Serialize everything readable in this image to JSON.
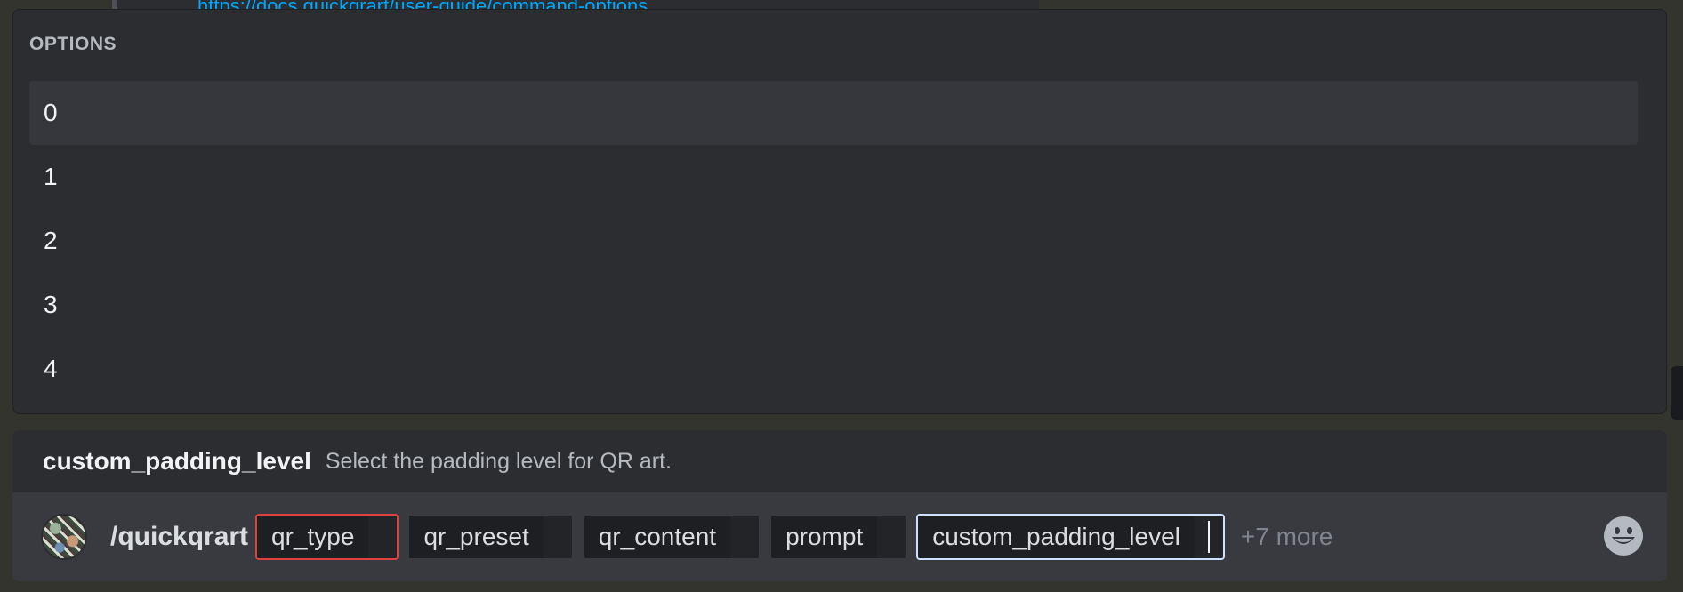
{
  "background": {
    "embed_link": "https://docs.quickqrart/user-guide/command-options"
  },
  "options": {
    "header": "OPTIONS",
    "items": [
      "0",
      "1",
      "2",
      "3",
      "4"
    ],
    "selected_index": 0
  },
  "command_info": {
    "name": "custom_padding_level",
    "description": "Select the padding level for QR art."
  },
  "input": {
    "command": "/quickqrart",
    "chips": [
      {
        "label": "qr_type",
        "state": "error"
      },
      {
        "label": "qr_preset",
        "state": "normal"
      },
      {
        "label": "qr_content",
        "state": "normal"
      },
      {
        "label": "prompt",
        "state": "normal"
      },
      {
        "label": "custom_padding_level",
        "state": "active"
      }
    ],
    "more": "+7 more",
    "emoji_icon": "smile-icon"
  },
  "colors": {
    "accent_link": "#00a8fc",
    "error_border": "#e04040",
    "active_border": "#cfe0ff"
  }
}
